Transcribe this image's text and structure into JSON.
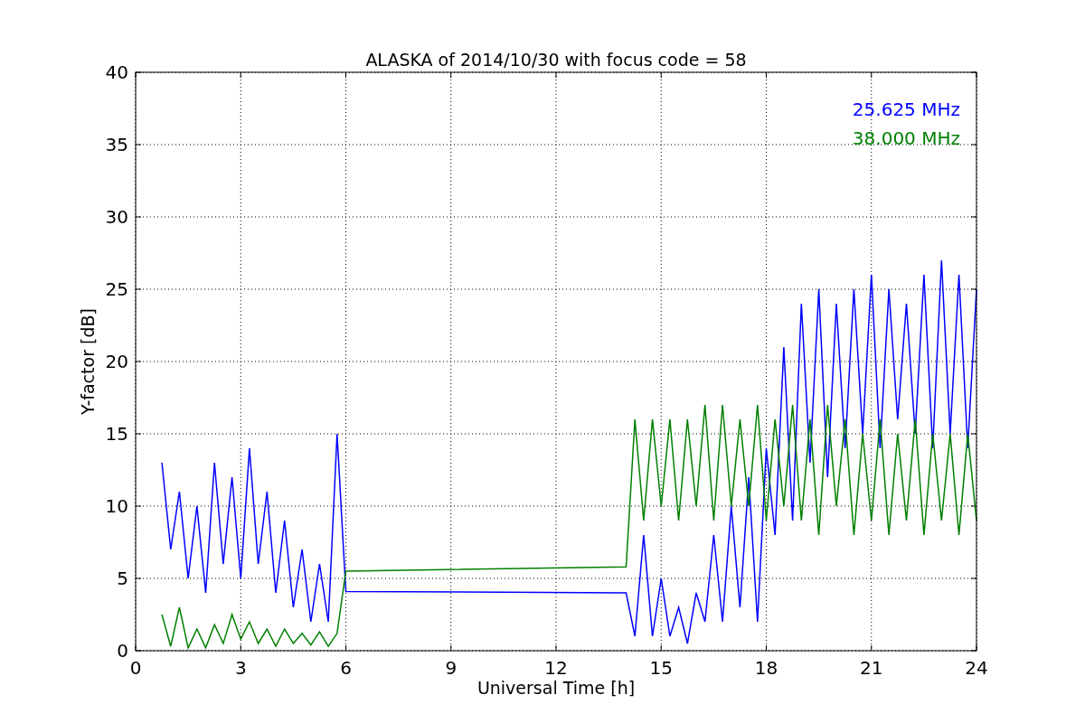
{
  "chart_data": {
    "type": "line",
    "title": "ALASKA of 2014/10/30 with focus code = 58",
    "xlabel": "Universal Time [h]",
    "ylabel": "Y-factor [dB]",
    "x": [
      0.75,
      1,
      1.25,
      1.5,
      1.75,
      2,
      2.25,
      2.5,
      2.75,
      3,
      3.25,
      3.5,
      3.75,
      4,
      4.25,
      4.5,
      4.75,
      5,
      5.25,
      5.5,
      5.75,
      6,
      14,
      14.25,
      14.5,
      14.75,
      15,
      15.25,
      15.5,
      15.75,
      16,
      16.25,
      16.5,
      16.75,
      17,
      17.25,
      17.5,
      17.75,
      18,
      18.25,
      18.5,
      18.75,
      19,
      19.25,
      19.5,
      19.75,
      20,
      20.25,
      20.5,
      20.75,
      21,
      21.25,
      21.5,
      21.75,
      22,
      22.25,
      22.5,
      22.75,
      23,
      23.25,
      23.5,
      23.75,
      24
    ],
    "series": [
      {
        "name": "25.625 MHz",
        "color": "#0000ff",
        "values": [
          13,
          7,
          11,
          5,
          10,
          4,
          13,
          6,
          12,
          5,
          14,
          6,
          11,
          4,
          9,
          3,
          7,
          2,
          6,
          2,
          15,
          4.1,
          4.0,
          1,
          8,
          1,
          5,
          1,
          3,
          0.5,
          4,
          2,
          8,
          2,
          10,
          3,
          12,
          2,
          14,
          8,
          21,
          9,
          24,
          13,
          25,
          12,
          24,
          14,
          25,
          15,
          26,
          14,
          25,
          16,
          24,
          15,
          26,
          14,
          27,
          15,
          26,
          14,
          25
        ]
      },
      {
        "name": "38.000 MHz",
        "color": "#008000",
        "values": [
          2.5,
          0.3,
          3,
          0.2,
          1.5,
          0.2,
          1.8,
          0.5,
          2.5,
          0.8,
          2,
          0.5,
          1.5,
          0.3,
          1.5,
          0.5,
          1.2,
          0.4,
          1.3,
          0.3,
          1.2,
          5.5,
          5.8,
          16,
          9,
          16,
          10,
          16,
          9,
          16,
          10,
          17,
          9,
          17,
          10,
          16,
          10,
          17,
          9,
          16,
          10,
          17,
          9,
          16,
          8,
          17,
          10,
          16,
          8,
          15,
          9,
          16,
          8,
          15,
          9,
          16,
          8,
          15,
          9,
          15,
          8,
          15,
          9
        ]
      }
    ],
    "xlim": [
      0,
      24
    ],
    "ylim": [
      0,
      40
    ],
    "grid": true,
    "xticks": [
      0,
      3,
      6,
      9,
      12,
      15,
      18,
      21,
      24
    ],
    "yticks": [
      0,
      5,
      10,
      15,
      20,
      25,
      30,
      35,
      40
    ]
  }
}
